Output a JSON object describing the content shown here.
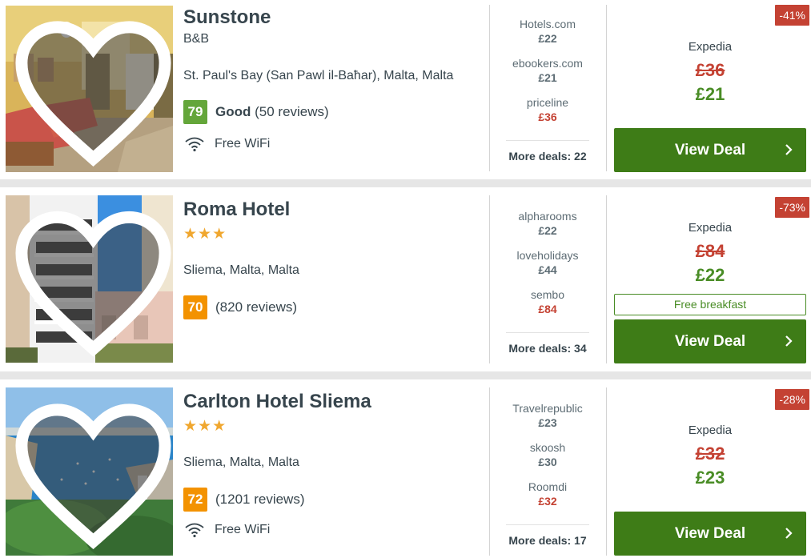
{
  "results": [
    {
      "name": "Sunstone",
      "subtype": "B&B",
      "stars": "",
      "location": "St. Paul's Bay (San Pawl il-Baħar), Malta, Malta",
      "score": "79",
      "score_word": "Good",
      "reviews": "(50 reviews)",
      "amenity": "Free WiFi",
      "deals": [
        {
          "provider": "Hotels.com",
          "price": "£22"
        },
        {
          "provider": "ebookers.com",
          "price": "£21"
        },
        {
          "provider": "priceline",
          "price": "£36"
        }
      ],
      "more_deals": "More deals: 22",
      "discount": "-41%",
      "best_provider": "Expedia",
      "old_price": "£36",
      "new_price": "£21",
      "perk": "",
      "button_label": "View Deal"
    },
    {
      "name": "Roma Hotel",
      "subtype": "",
      "stars": "★★★",
      "location": "Sliema, Malta, Malta",
      "score": "70",
      "score_word": "",
      "reviews": "(820 reviews)",
      "amenity": "",
      "deals": [
        {
          "provider": "alpharooms",
          "price": "£22"
        },
        {
          "provider": "loveholidays",
          "price": "£44"
        },
        {
          "provider": "sembo",
          "price": "£84"
        }
      ],
      "more_deals": "More deals: 34",
      "discount": "-73%",
      "best_provider": "Expedia",
      "old_price": "£84",
      "new_price": "£22",
      "perk": "Free breakfast",
      "button_label": "View Deal"
    },
    {
      "name": "Carlton Hotel Sliema",
      "subtype": "",
      "stars": "★★★",
      "location": "Sliema, Malta, Malta",
      "score": "72",
      "score_word": "",
      "reviews": "(1201 reviews)",
      "amenity": "Free WiFi",
      "deals": [
        {
          "provider": "Travelrepublic",
          "price": "£23"
        },
        {
          "provider": "skoosh",
          "price": "£30"
        },
        {
          "provider": "Roomdi",
          "price": "£32"
        }
      ],
      "more_deals": "More deals: 17",
      "discount": "-28%",
      "best_provider": "Expedia",
      "old_price": "£32",
      "new_price": "£23",
      "perk": "",
      "button_label": "View Deal"
    }
  ],
  "colors": {
    "score_good": "#64a63a",
    "score_ok": "#f39200",
    "cta": "#3e7c17",
    "discount": "#c44233",
    "price_green": "#498c25"
  },
  "icons": {
    "favourite": "heart-icon",
    "wifi": "wifi-icon",
    "cta": "chevron-right-icon"
  }
}
